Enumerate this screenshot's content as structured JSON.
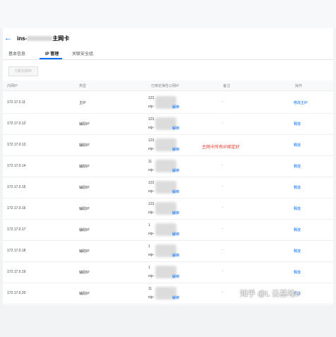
{
  "header": {
    "back_icon": "←",
    "title_prefix": "ins-",
    "title_suffix": "主网卡"
  },
  "tabs": [
    {
      "label": "基本信息"
    },
    {
      "label": "IP 管理"
    },
    {
      "label": "关联安全组"
    }
  ],
  "toolbar": {
    "assign_ip_label": "分配内网IP"
  },
  "table": {
    "headers": [
      "内网IP",
      "类型",
      "已绑定弹性公网IP",
      "备注",
      "操作"
    ],
    "rows": [
      {
        "private_ip": "172.17.0.11",
        "type": "主IP",
        "eip_prefix": "123.",
        "eip_label": "eip-",
        "bind": "解绑",
        "remark": "-",
        "action": "修改主IP"
      },
      {
        "private_ip": "172.17.0.12",
        "type": "辅助IP",
        "eip_prefix": "123.",
        "eip_label": "eip-",
        "bind": "解绑",
        "remark": "-",
        "action": "释放"
      },
      {
        "private_ip": "172.17.0.13",
        "type": "辅助IP",
        "eip_prefix": "123.",
        "eip_label": "eip-",
        "bind": "解绑",
        "remark": "",
        "action": "释放"
      },
      {
        "private_ip": "172.17.0.14",
        "type": "辅助IP",
        "eip_prefix": "11",
        "eip_label": "eip-",
        "bind": "解绑",
        "remark": "-",
        "action": "释放"
      },
      {
        "private_ip": "172.17.0.15",
        "type": "辅助IP",
        "eip_prefix": "123",
        "eip_label": "eip-",
        "bind": "解绑",
        "remark": "-",
        "action": "释放"
      },
      {
        "private_ip": "172.17.0.16",
        "type": "辅助IP",
        "eip_prefix": "123.",
        "eip_label": "eip-",
        "bind": "解绑",
        "remark": "-",
        "action": "释放"
      },
      {
        "private_ip": "172.17.0.17",
        "type": "辅助IP",
        "eip_prefix": "1",
        "eip_label": "eip-",
        "bind": "解绑",
        "remark": "-",
        "action": "释放"
      },
      {
        "private_ip": "172.17.0.18",
        "type": "辅助IP",
        "eip_prefix": "1",
        "eip_label": "eip-",
        "bind": "解绑",
        "remark": "-",
        "action": "释放"
      },
      {
        "private_ip": "172.17.0.19",
        "type": "辅助IP",
        "eip_prefix": "1",
        "eip_label": "eip-",
        "bind": "解绑",
        "remark": "-",
        "action": "释放"
      },
      {
        "private_ip": "172.17.0.20",
        "type": "辅助IP",
        "eip_prefix": "11",
        "eip_label": "eip-",
        "bind": "解绑",
        "remark": "-",
        "action": "释放"
      }
    ]
  },
  "annotation": "主网卡所有IP绑定好",
  "watermark": "知乎 @L 云基地e",
  "colors": {
    "accent": "#006eff",
    "annotation": "#e8362c"
  }
}
